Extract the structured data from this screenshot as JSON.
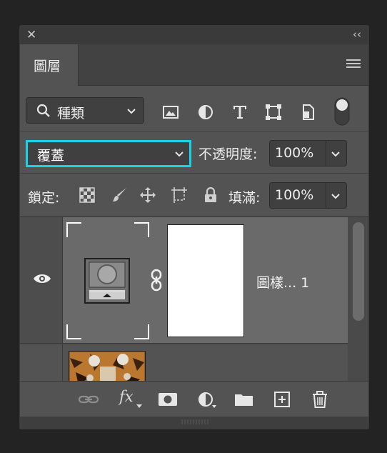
{
  "titlebar": {
    "close_glyph": "✕",
    "collapse_glyph": "‹‹"
  },
  "tab": {
    "label": "圖層"
  },
  "filter": {
    "kind_label": "種類",
    "icons": [
      "image-filter-icon",
      "adjustment-filter-icon",
      "type-filter-icon",
      "shape-filter-icon",
      "smart-object-filter-icon",
      "filter-toggle-switch"
    ]
  },
  "blend": {
    "mode": "覆蓋",
    "opacity_label": "不透明度:",
    "opacity_value": "100%"
  },
  "lock": {
    "label": "鎖定:",
    "icons": [
      "lock-transparent-pixels-icon",
      "lock-image-pixels-icon",
      "lock-position-icon",
      "lock-artboard-icon",
      "lock-all-icon"
    ],
    "fill_label": "填滿:",
    "fill_value": "100%"
  },
  "layers": [
    {
      "name": "圖樣... 1",
      "visible": true,
      "selected": true
    },
    {
      "name": "",
      "visible": false,
      "selected": false
    }
  ],
  "bottom_toolbar": {
    "fx_label": "fx",
    "icons": [
      "link-layers-icon",
      "fx-icon",
      "add-mask-icon",
      "new-adjustment-layer-icon",
      "new-group-icon",
      "new-layer-icon",
      "delete-layer-icon"
    ]
  },
  "colors": {
    "focus_ring": "#19d3e5",
    "panel_bg": "#535353",
    "selected_layer": "#6a6a6a"
  }
}
